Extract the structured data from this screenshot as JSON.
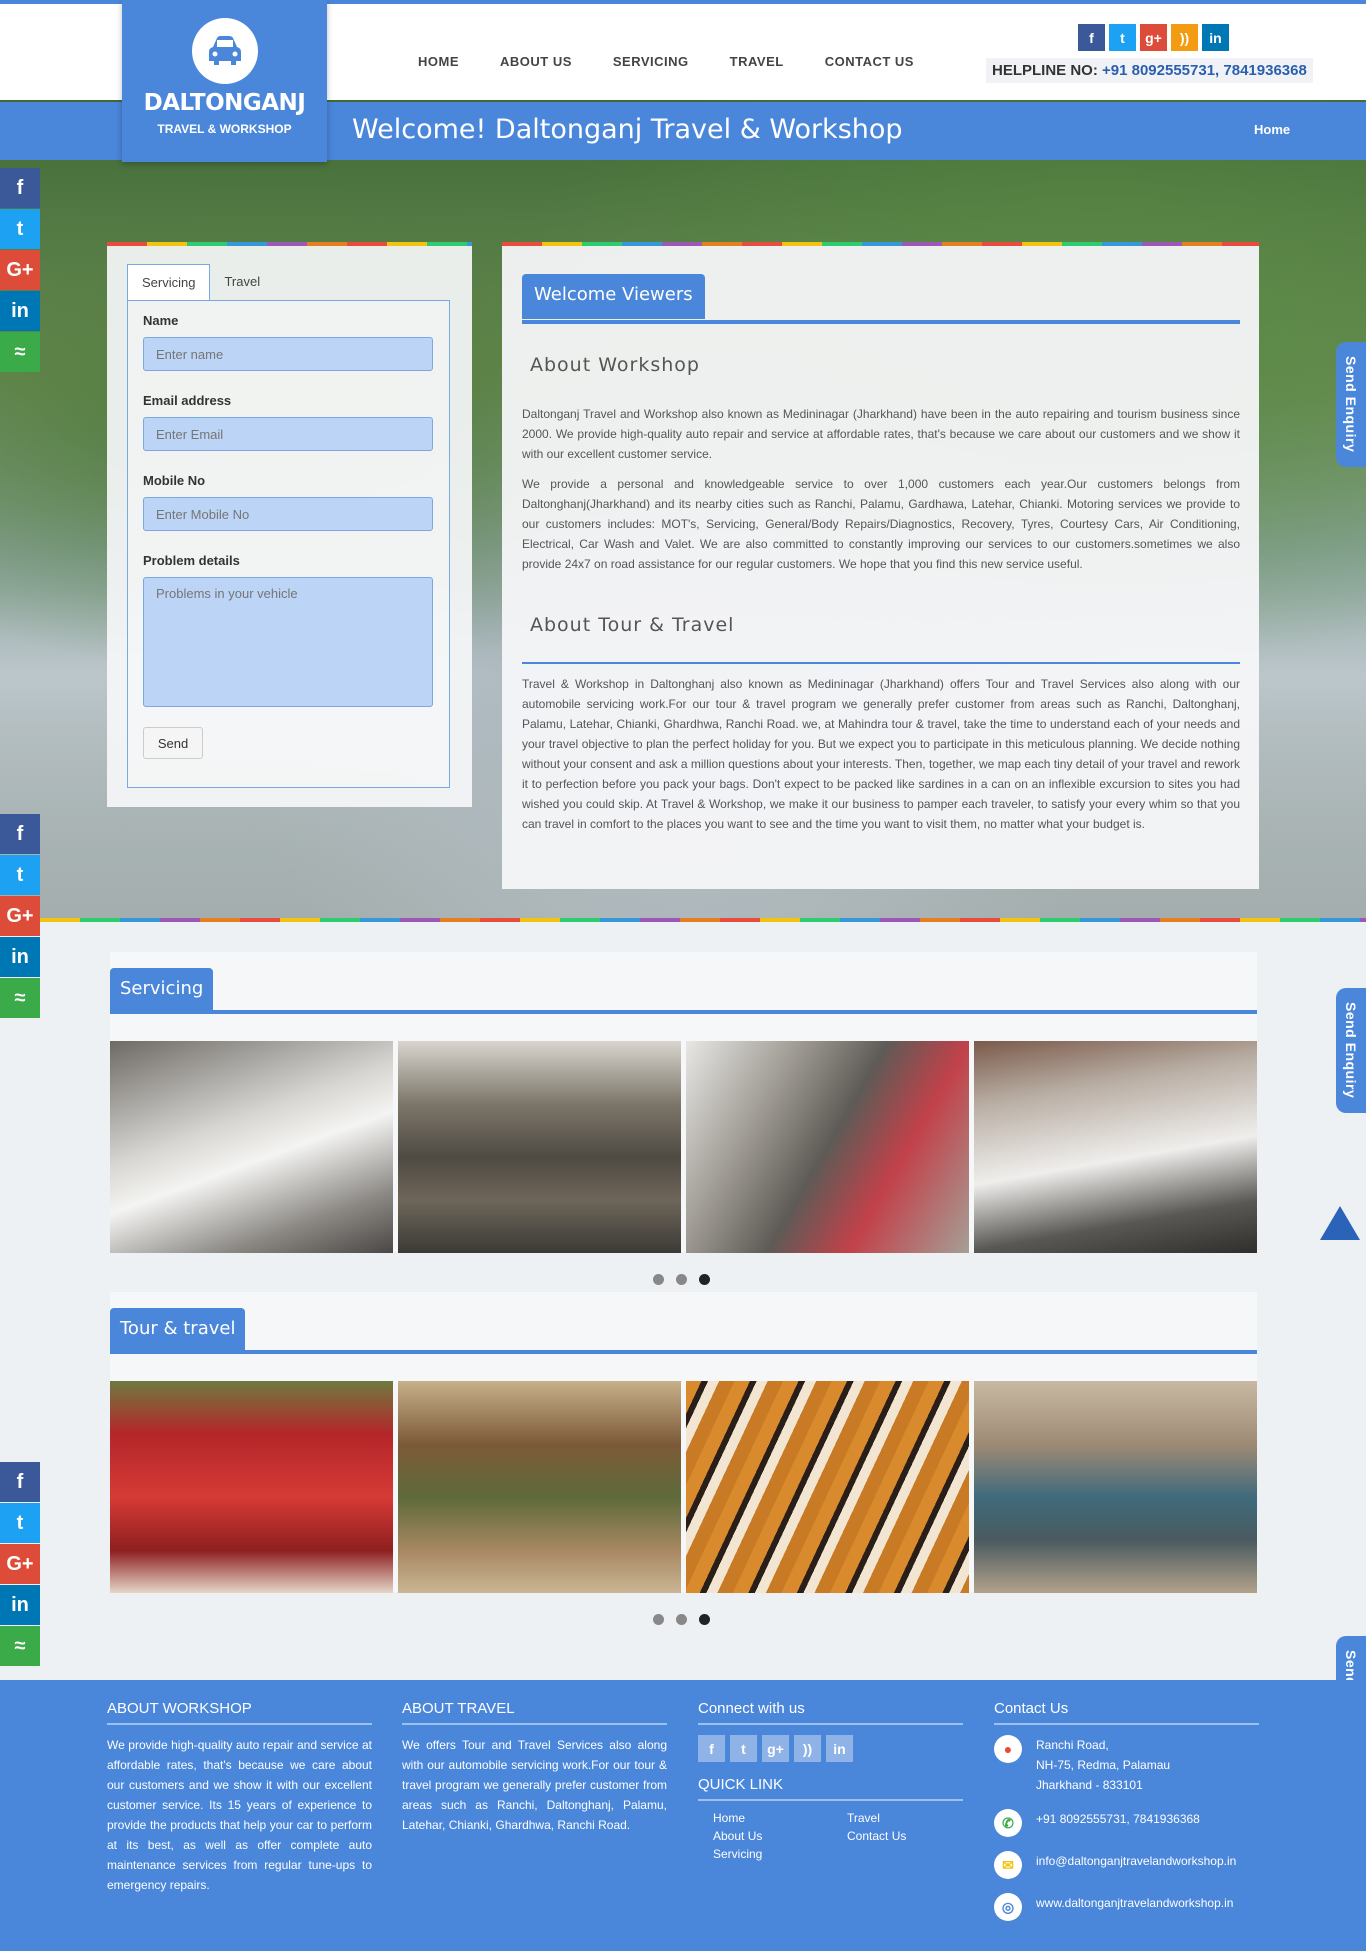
{
  "brand": {
    "name": "DALTONGANJ",
    "tagline": "TRAVEL & WORKSHOP"
  },
  "nav": [
    "HOME",
    "ABOUT US",
    "SERVICING",
    "TRAVEL",
    "CONTACT US"
  ],
  "helpline": {
    "label": "HELPLINE NO:",
    "numbers": "+91 8092555731, 7841936368"
  },
  "welcome_bar": {
    "title": "Welcome! Daltonganj Travel & Workshop",
    "breadcrumb": "Home"
  },
  "form": {
    "tabs": [
      "Servicing",
      "Travel"
    ],
    "name_label": "Name",
    "name_placeholder": "Enter name",
    "email_label": "Email address",
    "email_placeholder": "Enter Email",
    "mobile_label": "Mobile No",
    "mobile_placeholder": "Enter Mobile No",
    "problem_label": "Problem details",
    "problem_placeholder": "Problems in your vehicle",
    "send_label": "Send"
  },
  "content": {
    "tab": "Welcome Viewers",
    "workshop_heading": "About Workshop",
    "workshop_p1": "Daltonganj Travel and Workshop also known as Medininagar (Jharkhand) have been in the auto repairing and tourism business since 2000. We provide high-quality auto repair and service at affordable rates, that's because we care about our customers and we show it with our excellent customer service.",
    "workshop_p2": "We provide a personal and knowledgeable service to over 1,000 customers each year.Our customers belongs from Daltonghanj(Jharkhand) and its nearby cities such as Ranchi, Palamu, Gardhawa, Latehar, Chianki. Motoring services we provide to our customers includes: MOT's, Servicing, General/Body Repairs/Diagnostics, Recovery, Tyres, Courtesy Cars, Air Conditioning, Electrical, Car Wash and Valet. We are also committed to constantly improving our services to our customers.sometimes we also provide 24x7 on road assistance for our regular customers. We hope that you find this new service useful.",
    "travel_heading": "About Tour & Travel",
    "travel_p": "Travel & Workshop in Daltonghanj also known as Medininagar (Jharkhand) offers Tour and Travel Services also along with our automobile servicing work.For our tour & travel program we generally prefer customer from areas such as Ranchi, Daltonghanj, Palamu, Latehar, Chianki, Ghardhwa, Ranchi Road. we, at Mahindra tour & travel, take the time to understand each of your needs and your travel objective to plan the perfect holiday for you. But we expect you to participate in this meticulous planning. We decide nothing without your consent and ask a million questions about your interests. Then, together, we map each tiny detail of your travel and rework it to perfection before you pack your bags. Don't expect to be packed like sardines in a can on an inflexible excursion to sites you had wished you could skip. At Travel & Workshop, we make it our business to pamper each traveler, to satisfy your every whim so that you can travel in comfort to the places you want to see and the time you want to visit them, no matter what your budget is."
  },
  "enquiry_label": "Send Enquiry",
  "servicing": {
    "title": "Servicing"
  },
  "tour": {
    "title": "Tour & travel"
  },
  "footer": {
    "about_workshop_h": "ABOUT WORKSHOP",
    "about_workshop_p": "We provide high-quality auto repair and service at affordable rates, that's because we care about our customers and we show it with our excellent customer service. Its 15 years of experience to provide the products that help your car to perform at its best, as well as offer complete auto maintenance services from regular tune-ups to emergency repairs.",
    "about_travel_h": "ABOUT TRAVEL",
    "about_travel_p": "We offers Tour and Travel Services also along with our automobile servicing work.For our tour & travel program we generally prefer customer from areas such as Ranchi, Daltonghanj, Palamu, Latehar, Chianki, Ghardhwa, Ranchi Road.",
    "connect_h": "Connect with us",
    "quick_h": "QUICK LINK",
    "quick_links": [
      "Home",
      "Travel",
      "About Us",
      "Contact Us",
      "Servicing"
    ],
    "contact_h": "Contact Us",
    "address_1": "Ranchi Road,",
    "address_2": "NH-75, Redma, Palamau",
    "address_3": "Jharkhand - 833101",
    "phone": "+91 8092555731, 7841936368",
    "email": "info@daltonganjtravelandworkshop.in",
    "web": "www.daltonganjtravelandworkshop.in"
  },
  "colors": {
    "brand": "#4a86d9",
    "facebook": "#3b5998",
    "twitter": "#1da1f2",
    "google": "#dd4b39",
    "linkedin": "#0077b5",
    "share": "#3bab4a"
  }
}
